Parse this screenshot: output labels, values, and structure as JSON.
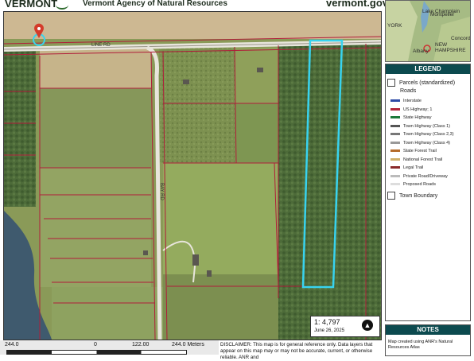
{
  "header": {
    "state_label": "VERMONT",
    "agency": "Vermont Agency of Natural Resources",
    "website": "vermont.gov"
  },
  "map": {
    "road_label_top": "LINE RD",
    "road_label_vertical": "BAY RD",
    "pin_icon": "location-pin-icon",
    "highlight_color": "#38d3ef"
  },
  "scale_badge": {
    "ratio": "1:  4,797",
    "date": "June 26, 2025",
    "north_symbol": "▲"
  },
  "scalebar": {
    "left": "244.0",
    "zero": "0",
    "mid": "122.00",
    "right": "244.0 Meters"
  },
  "disclaimer": "DISCLAIMER: This map is for general reference only. Data layers that appear on this map may or may not be accurate, current, or otherwise reliable. ANR and",
  "inset": {
    "labels": [
      "Lake Champlain",
      "Montpelier",
      "YORK",
      "Albany",
      "NEW HAMPSHIRE",
      "Concord"
    ]
  },
  "legend": {
    "title": "LEGEND",
    "parcels": "Parcels (standardized)",
    "roads_heading": "Roads",
    "road_items": [
      {
        "label": "Interstate",
        "color": "#2c4aa6"
      },
      {
        "label": "US Highway; 1",
        "color": "#b0263a"
      },
      {
        "label": "State Highway",
        "color": "#1c7a3a"
      },
      {
        "label": "Town Highway (Class 1)",
        "color": "#555555"
      },
      {
        "label": "Town Highway (Class 2,3)",
        "color": "#777777"
      },
      {
        "label": "Town Highway (Class 4)",
        "color": "#999999"
      },
      {
        "label": "State Forest Trail",
        "color": "#b56b2a"
      },
      {
        "label": "National Forest Trail",
        "color": "#cfb06a"
      },
      {
        "label": "Legal Trail",
        "color": "#8a2a2a"
      },
      {
        "label": "Private Road/Driveway",
        "color": "#bbbbbb"
      },
      {
        "label": "Proposed Roads",
        "color": "#dddddd"
      }
    ],
    "town_boundary": "Town Boundary"
  },
  "notes": {
    "title": "NOTES",
    "text": "Map created using ANR's Natural Resources Atlas"
  }
}
